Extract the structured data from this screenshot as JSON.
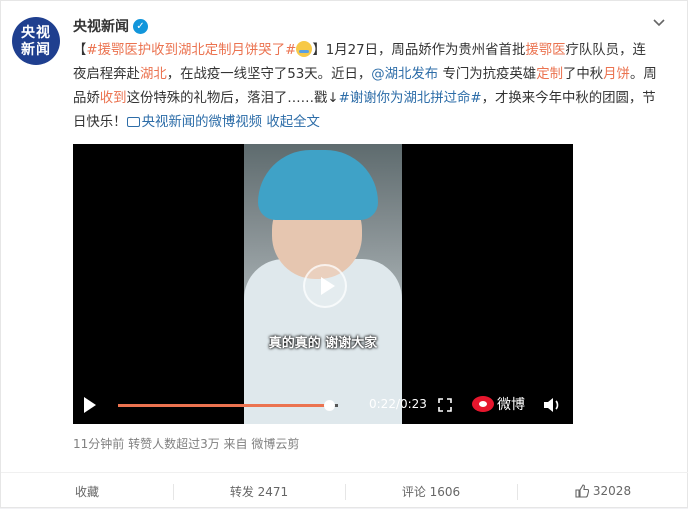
{
  "author": {
    "name": "央视新闻",
    "avatar_line1": "央视",
    "avatar_line2": "新闻"
  },
  "post": {
    "tag1": "#援鄂医护收到湖北定制月饼哭了#",
    "seg1": "】1月27日，周品娇作为贵州省首批",
    "kw_aid1": "援鄂医",
    "seg2": "疗队队员，连夜启程奔赴",
    "kw_hubei1": "湖北",
    "seg3": "，在战疫一线坚守了53天。近日，",
    "mention": "@湖北发布",
    "seg4": " 专门为抗疫英雄",
    "kw_custom": "定制",
    "seg5": "了中秋",
    "kw_mooncake": "月饼",
    "seg6": "。周品娇",
    "kw_received": "收到",
    "seg7": "这份特殊的礼物后，落泪了……戳↓",
    "tag2": "#谢谢你为湖北拼过命#",
    "seg8": "，才换来今年中秋的团圆，节日快乐！",
    "video_link": "央视新闻的微博视频",
    "collapse_link": "收起全文"
  },
  "video": {
    "subtitle": "真的真的 谢谢大家",
    "timecode": "0:22/0:23",
    "progress": 0.96,
    "brand": "微博"
  },
  "meta": {
    "text": "11分钟前 转赞人数超过3万 来自 微博云剪"
  },
  "actions": {
    "favorite": "收藏",
    "repost": "转发 2471",
    "comment": "评论 1606",
    "like_count": "32028"
  },
  "colors": {
    "accent": "#eb7350",
    "link": "#2d6da8",
    "weibo_red": "#e6162d"
  }
}
